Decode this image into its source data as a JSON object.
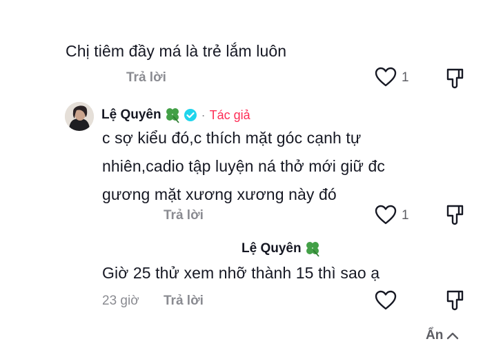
{
  "comments": [
    {
      "text": "Chị tiêm đầy má là trẻ lắm luôn",
      "reply_label": "Trả lời",
      "likes": "1"
    },
    {
      "author": "Lệ Quyên",
      "author_badge": "Tác giả",
      "dot": "·",
      "text_lines": [
        "c sợ kiểu đó,c thích mặt góc cạnh tự",
        "nhiên,cadio tập luyện ná thở mới giữ đc",
        "gương mặt xương xương này đó"
      ],
      "reply_label": "Trả lời",
      "likes": "1"
    },
    {
      "quoted_author": "Lệ Quyên",
      "text": "Giờ 25 thử xem nhỡ thành 15 thì sao ạ",
      "time": "23 giờ",
      "reply_label": "Trả lời"
    }
  ],
  "hide_label": "Ẩn",
  "colors": {
    "accent": "#fe2c55",
    "verified": "#20d5ec",
    "clover": "#43a047"
  }
}
